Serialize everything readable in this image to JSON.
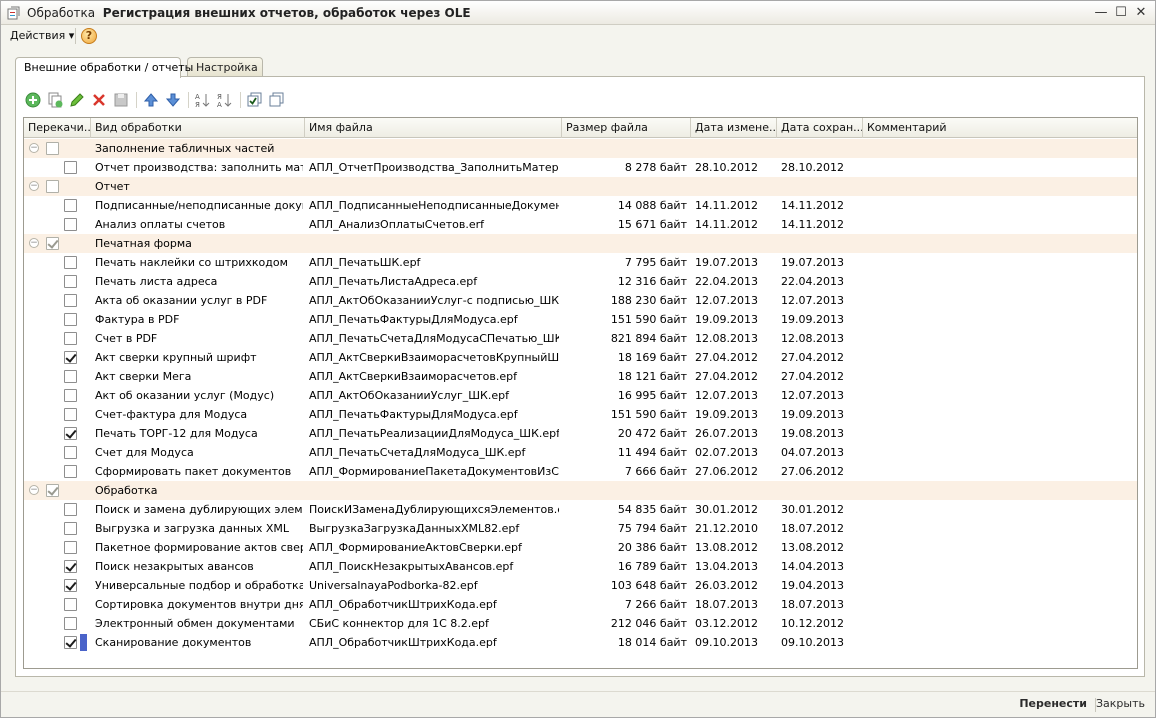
{
  "window": {
    "title_prefix": "Обработка",
    "title": "Регистрация внешних отчетов, обработок через OLE",
    "minimize_glyph": "—",
    "maximize_glyph": "☐",
    "close_glyph": "✕"
  },
  "menu": {
    "actions_label": "Действия ▾",
    "help_glyph": "?"
  },
  "tabs": [
    {
      "label": "Внешние обработки / отчеты",
      "active": true
    },
    {
      "label": "Настройка",
      "active": false
    }
  ],
  "toolbar": {
    "buttons": [
      "add-icon",
      "copy-icon",
      "edit-icon",
      "delete-icon",
      "save-icon",
      "move-up-icon",
      "move-down-icon",
      "sort-asc-icon",
      "sort-desc-icon",
      "check-all-icon",
      "uncheck-all-icon"
    ]
  },
  "grid": {
    "columns": [
      "Перекачи...",
      "Вид обработки",
      "Имя файла",
      "Размер файла",
      "Дата измене...",
      "Дата сохран...",
      "Комментарий"
    ],
    "rows": [
      {
        "type": "group",
        "name": "Заполнение табличных частей",
        "checked": false
      },
      {
        "type": "item",
        "checked": false,
        "name": "Отчет производства: заполнить матер...",
        "file": "АПЛ_ОтчетПроизводства_ЗаполнитьМатериа...",
        "size": "8 278 байт",
        "modified": "28.10.2012",
        "saved": "28.10.2012"
      },
      {
        "type": "group",
        "name": "Отчет",
        "checked": false
      },
      {
        "type": "item",
        "checked": false,
        "name": "Подписанные/неподписанные докуме...",
        "file": "АПЛ_ПодписанныеНеподписанныеДокументы...",
        "size": "14 088 байт",
        "modified": "14.11.2012",
        "saved": "14.11.2012"
      },
      {
        "type": "item",
        "checked": false,
        "name": "Анализ оплаты счетов",
        "file": "АПЛ_АнализОплатыСчетов.erf",
        "size": "15 671 байт",
        "modified": "14.11.2012",
        "saved": "14.11.2012"
      },
      {
        "type": "group",
        "name": "Печатная форма",
        "checked": true
      },
      {
        "type": "item",
        "checked": false,
        "name": "Печать наклейки со штрихкодом",
        "file": "АПЛ_ПечатьШК.epf",
        "size": "7 795 байт",
        "modified": "19.07.2013",
        "saved": "19.07.2013"
      },
      {
        "type": "item",
        "checked": false,
        "name": "Печать листа адреса",
        "file": "АПЛ_ПечатьЛистаАдреса.epf",
        "size": "12 316 байт",
        "modified": "22.04.2013",
        "saved": "22.04.2013"
      },
      {
        "type": "item",
        "checked": false,
        "name": "Акта об оказании услуг в PDF",
        "file": "АПЛ_АктОбОказанииУслуг-с подписью_ШК.epf",
        "size": "188 230 байт",
        "modified": "12.07.2013",
        "saved": "12.07.2013"
      },
      {
        "type": "item",
        "checked": false,
        "name": "Фактура в PDF",
        "file": "АПЛ_ПечатьФактурыДляМодуса.epf",
        "size": "151 590 байт",
        "modified": "19.09.2013",
        "saved": "19.09.2013"
      },
      {
        "type": "item",
        "checked": false,
        "name": "Счет в PDF",
        "file": "АПЛ_ПечатьСчетаДляМодусаСПечатью_ШК.epf",
        "size": "821 894 байт",
        "modified": "12.08.2013",
        "saved": "12.08.2013"
      },
      {
        "type": "item",
        "checked": true,
        "name": "Акт сверки крупный шрифт",
        "file": "АПЛ_АктСверкиВзаиморасчетовКрупныйШри...",
        "size": "18 169 байт",
        "modified": "27.04.2012",
        "saved": "27.04.2012"
      },
      {
        "type": "item",
        "checked": false,
        "name": "Акт сверки Мега",
        "file": "АПЛ_АктСверкиВзаиморасчетов.epf",
        "size": "18 121 байт",
        "modified": "27.04.2012",
        "saved": "27.04.2012"
      },
      {
        "type": "item",
        "checked": false,
        "name": "Акт об оказании услуг (Модус)",
        "file": "АПЛ_АктОбОказанииУслуг_ШК.epf",
        "size": "16 995 байт",
        "modified": "12.07.2013",
        "saved": "12.07.2013"
      },
      {
        "type": "item",
        "checked": false,
        "name": "Счет-фактура для Модуса",
        "file": "АПЛ_ПечатьФактурыДляМодуса.epf",
        "size": "151 590 байт",
        "modified": "19.09.2013",
        "saved": "19.09.2013"
      },
      {
        "type": "item",
        "checked": true,
        "name": "Печать ТОРГ-12 для Модуса",
        "file": "АПЛ_ПечатьРеализацииДляМодуса_ШК.epf",
        "size": "20 472 байт",
        "modified": "26.07.2013",
        "saved": "19.08.2013"
      },
      {
        "type": "item",
        "checked": false,
        "name": "Счет для Модуса",
        "file": "АПЛ_ПечатьСчетаДляМодуса_ШК.epf",
        "size": "11 494 байт",
        "modified": "02.07.2013",
        "saved": "04.07.2013"
      },
      {
        "type": "item",
        "checked": false,
        "name": "Сформировать пакет документов",
        "file": "АПЛ_ФормированиеПакетаДокументовИзСче...",
        "size": "7 666 байт",
        "modified": "27.06.2012",
        "saved": "27.06.2012"
      },
      {
        "type": "group",
        "name": "Обработка",
        "checked": true
      },
      {
        "type": "item",
        "checked": false,
        "name": "Поиск и замена дублирующих элемен...",
        "file": "ПоискИЗаменаДублирующихсяЭлементов.epf",
        "size": "54 835 байт",
        "modified": "30.01.2012",
        "saved": "30.01.2012"
      },
      {
        "type": "item",
        "checked": false,
        "name": "Выгрузка и загрузка данных XML",
        "file": "ВыгрузкаЗагрузкаДанныхXML82.epf",
        "size": "75 794 байт",
        "modified": "21.12.2010",
        "saved": "18.07.2012"
      },
      {
        "type": "item",
        "checked": false,
        "name": "Пакетное формирование актов сверки",
        "file": "АПЛ_ФормированиеАктовСверки.epf",
        "size": "20 386 байт",
        "modified": "13.08.2012",
        "saved": "13.08.2012"
      },
      {
        "type": "item",
        "checked": true,
        "name": "Поиск незакрытых авансов",
        "file": "АПЛ_ПоискНезакрытыхАвансов.epf",
        "size": "16 789 байт",
        "modified": "13.04.2013",
        "saved": "14.04.2013"
      },
      {
        "type": "item",
        "checked": true,
        "name": "Универсальные подбор и обработка о...",
        "file": "UniversalnayaPodborka-82.epf",
        "size": "103 648 байт",
        "modified": "26.03.2012",
        "saved": "19.04.2013"
      },
      {
        "type": "item",
        "checked": false,
        "name": "Сортировка документов внутри дня",
        "file": "АПЛ_ОбработчикШтрихКода.epf",
        "size": "7 266 байт",
        "modified": "18.07.2013",
        "saved": "18.07.2013"
      },
      {
        "type": "item",
        "checked": false,
        "name": "Электронный обмен документами",
        "file": "СБиС коннектор для 1С 8.2.epf",
        "size": "212 046 байт",
        "modified": "03.12.2012",
        "saved": "10.12.2012"
      },
      {
        "type": "item",
        "checked": true,
        "focused": true,
        "name": "Сканирование документов",
        "file": "АПЛ_ОбработчикШтрихКода.epf",
        "size": "18 014 байт",
        "modified": "09.10.2013",
        "saved": "09.10.2013"
      }
    ]
  },
  "footer": {
    "transfer_label": "Перенести",
    "close_label": "Закрыть"
  },
  "colors": {
    "group_row_bg": "#fbf0e4",
    "window_bg": "#f4f4ee",
    "focus_marker": "#4a63c9"
  }
}
